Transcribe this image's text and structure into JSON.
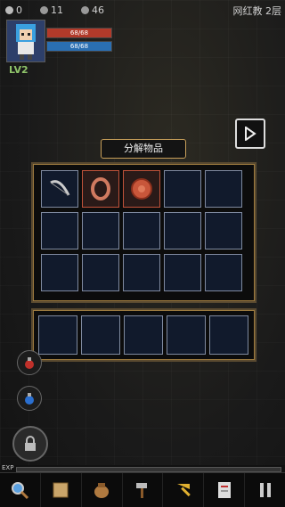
{
  "top": {
    "resources": [
      {
        "name": "coin-icon",
        "value": "0"
      },
      {
        "name": "gem-icon",
        "value": "11"
      },
      {
        "name": "skull-icon",
        "value": "46"
      }
    ],
    "location": "网红教 2层"
  },
  "player": {
    "level": "LV2",
    "hp": "68/68",
    "mp": "68/68"
  },
  "dialog": {
    "title": "分解物品",
    "rows": 3,
    "cols": 5,
    "items": [
      {
        "slot": 0,
        "icon": "bow-icon",
        "highlight": false
      },
      {
        "slot": 1,
        "icon": "ring-icon",
        "highlight": true
      },
      {
        "slot": 2,
        "icon": "shield-icon",
        "highlight": true
      }
    ],
    "result_slots": 5
  },
  "side_buttons": [
    {
      "icon": "red-potion-icon"
    },
    {
      "icon": "blue-potion-icon"
    },
    {
      "icon": "lock-icon"
    }
  ],
  "exp_label": "EXP",
  "toolbar": [
    {
      "icon": "magnifier-icon"
    },
    {
      "icon": "map-scroll-icon"
    },
    {
      "icon": "bag-icon"
    },
    {
      "icon": "hammer-icon"
    },
    {
      "icon": "arrow-icon"
    },
    {
      "icon": "quest-note-icon"
    },
    {
      "icon": "pause-icon"
    }
  ],
  "colors": {
    "hp": "#b23a2a",
    "mp": "#2a6fb2",
    "level": "#8fc46a",
    "slot_border": "#7f8aa0",
    "highlight_border": "#c0523a"
  }
}
